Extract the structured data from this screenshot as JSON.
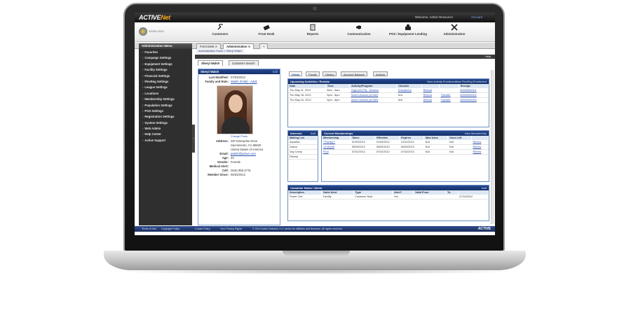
{
  "header": {
    "logo_main": "ACTIVE",
    "logo_accent": "Net",
    "welcome": "Welcome, Admin Resource!",
    "account": "Account"
  },
  "org": {
    "name": "YOUR LOGO"
  },
  "nav": [
    {
      "label": "Customers",
      "icon": "wrench-icon"
    },
    {
      "label": "Front Desk",
      "icon": "ticket-icon"
    },
    {
      "label": "Reports",
      "icon": "document-icon"
    },
    {
      "label": "Communication",
      "icon": "megaphone-icon"
    },
    {
      "label": "POS / Equipment Lending",
      "icon": "pos-icon"
    },
    {
      "label": "Administration",
      "icon": "tools-icon"
    }
  ],
  "app_tabs": [
    "Front Desk",
    "Administration"
  ],
  "breadcrumb": "Administration Home » Sheryl Walsh",
  "help": "Help",
  "sidebar": {
    "title": "Administration Menu",
    "items": [
      "Favorites",
      "Campaign Settings",
      "Equipment Settings",
      "Facility Settings",
      "Financial Settings",
      "FlexReg Settings",
      "League Settings",
      "Locations",
      "Membership Settings",
      "Population Settings",
      "POS Settings",
      "Registration Settings",
      "System Settings",
      "Web Admin",
      "Help Center",
      "Active Support"
    ]
  },
  "customer_tabs": [
    "Sheryl Walsh",
    "Customer Search"
  ],
  "profile": {
    "name": "Sheryl Walsh",
    "edit": "Edit",
    "last_modified_label": "Last Modified:",
    "last_modified": "07/03/2012",
    "family_label": "Family and Role:",
    "family": "Walsh (#158) : Adult",
    "change_photo": "Change Photo",
    "address_label": "Address:",
    "address_1": "287 Enterprise Drive",
    "address_2": "Sacramento, CA 95820",
    "address_3": "United States of America",
    "email_label": "Email:",
    "email": "jwalsh@active.com",
    "age_label": "Age:",
    "age": "33",
    "gender_label": "Gender:",
    "gender": "Female",
    "medical_label": "Medical Alert:",
    "medical": "",
    "cell_label": "Cell:",
    "cell": "(916) 955-2775",
    "member_since_label": "Member Since:",
    "member_since": "05/03/2012"
  },
  "content_tabs": [
    "Detail",
    "Family",
    "History",
    "Account Balance",
    "Actions"
  ],
  "activities": {
    "title": "Upcoming Activities / Rentals",
    "action1": "New Activity Enrollment",
    "action2": "New FlexReg Enrollment",
    "columns": [
      "Date",
      "Time",
      "Activity/Program",
      "Checkin",
      "",
      "",
      "Receipt"
    ],
    "rows": [
      [
        "Thu May 11, 2012",
        "8am - 9am",
        "Yoga (#1075) - Session",
        "Checked-in",
        "Refund",
        "",
        "#0000000001"
      ],
      [
        "Thu May 18, 2012",
        "5pm - 6pm",
        "Swim Lessons (#1082)",
        "N/A",
        "Refund",
        "Transfer",
        "#0000000002"
      ],
      [
        "Thu May 24, 2012",
        "5pm - 6pm",
        "Swim Lessons (#1082)",
        "N/A",
        "Refund",
        "Transfer",
        "#0000000003"
      ]
    ]
  },
  "interests": {
    "title": "Interests",
    "action": "Add",
    "column": "Mailing List",
    "rows": [
      "Aquatics",
      "Dance",
      "Day Camp",
      "Fitness"
    ]
  },
  "memberships": {
    "title": "Current Memberships",
    "action": "New Membership",
    "columns": [
      "Membership",
      "Since",
      "Effective",
      "Expires",
      "Max Uses",
      "Uses Left",
      ""
    ],
    "rows": [
      [
        "**Family**",
        "01/09/2012",
        "01/09/2012",
        "12/31/2012",
        "N/A",
        "N/A",
        "Renew"
      ],
      [
        "12 Month",
        "05/09/2012",
        "05/09/2012",
        "05/09/2013",
        "N/A",
        "N/A",
        "Renew"
      ],
      [
        "Pool",
        "07/22/2012",
        "07/22/2012",
        "07/22/2013",
        "N/A",
        "N/A",
        "Renew"
      ]
    ]
  },
  "notes": {
    "title": "Customer Notes / Alerts",
    "action": "Add",
    "columns": [
      "Description",
      "Note/ Alert",
      "Type",
      "Alert?",
      "Valid From",
      "To",
      ""
    ],
    "rows": [
      [
        "Power Cell",
        "Facility",
        "Customer Note",
        "Yes",
        "",
        "",
        "07/18/2012"
      ]
    ]
  },
  "footer": {
    "terms": "Terms of Use",
    "copyright": "Copyright Policy",
    "cookie": "Cookie Policy",
    "privacy": "Your Privacy Rights",
    "legal": "© 2014 Active Network, LLC and/or its affiliates and licensors. All rights reserved.",
    "brand": "ACTIVE"
  },
  "colors": {
    "nav_blue": "#1b3a78",
    "accent_orange": "#f5a623",
    "sidebar": "#2f2f2f"
  }
}
